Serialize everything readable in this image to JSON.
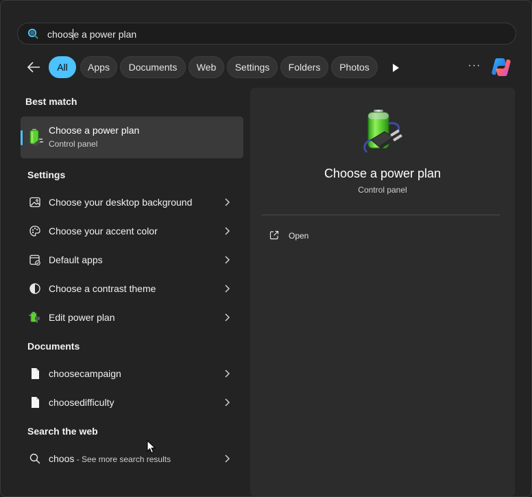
{
  "search": {
    "typed": "choos",
    "autocomplete": "e a power plan",
    "icon": "search-icon"
  },
  "filters": {
    "back_icon": "back-arrow-icon",
    "chips": [
      "All",
      "Apps",
      "Documents",
      "Web",
      "Settings",
      "Folders",
      "Photos"
    ],
    "active": "All",
    "more_icon": "play-icon",
    "overflow_label": "···",
    "copilot_icon": "copilot-icon"
  },
  "best_match": {
    "header": "Best match",
    "title": "Choose a power plan",
    "subtitle": "Control panel",
    "icon": "battery-plug-icon"
  },
  "settings": {
    "header": "Settings",
    "items": [
      {
        "label": "Choose your desktop background",
        "icon": "image-icon"
      },
      {
        "label": "Choose your accent color",
        "icon": "palette-icon"
      },
      {
        "label": "Default apps",
        "icon": "default-apps-icon"
      },
      {
        "label": "Choose a contrast theme",
        "icon": "contrast-icon"
      },
      {
        "label": "Edit power plan",
        "icon": "power-plan-icon"
      }
    ]
  },
  "documents": {
    "header": "Documents",
    "items": [
      {
        "label": "choosecampaign",
        "icon": "document-icon"
      },
      {
        "label": "choosedifficulty",
        "icon": "document-icon"
      }
    ]
  },
  "web": {
    "header": "Search the web",
    "query": "choos",
    "suffix": " - See more search results",
    "icon": "search-icon"
  },
  "preview": {
    "title": "Choose a power plan",
    "subtitle": "Control panel",
    "open_label": "Open",
    "open_icon": "open-external-icon"
  },
  "colors": {
    "accent": "#4cc2ff",
    "background": "#232323",
    "selected": "#3a3a3a"
  }
}
